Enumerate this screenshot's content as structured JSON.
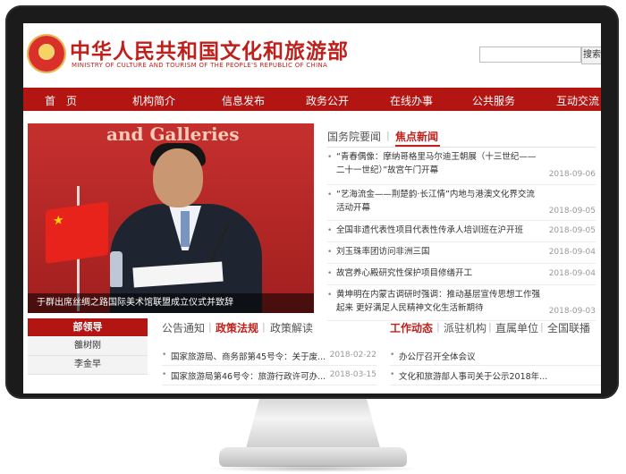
{
  "header": {
    "title": "中华人民共和国文化和旅游部",
    "subtitle": "MINISTRY OF CULTURE AND TOURISM OF THE PEOPLE'S REPUBLIC OF CHINA",
    "search_button": "搜索"
  },
  "nav": [
    "首　页",
    "机构简介",
    "信息发布",
    "政务公开",
    "在线办事",
    "公共服务",
    "互动交流"
  ],
  "hero": {
    "background_text": "and Galleries",
    "caption": "于群出席丝绸之路国际美术馆联盟成立仪式并致辞"
  },
  "news_tabs": [
    "国务院要闻",
    "焦点新闻"
  ],
  "news": [
    {
      "text": "“青春偶像：摩纳哥格里马尔迪王朝展（十三世纪——二十一世纪）”故宫午门开幕",
      "date": "2018-09-06"
    },
    {
      "text": "“艺海流金——荆楚韵·长江情”内地与港澳文化界交流活动开幕",
      "date": "2018-09-05"
    },
    {
      "text": "全国非遗代表性项目代表性传承人培训班在沪开班",
      "date": "2018-09-05"
    },
    {
      "text": "刘玉珠率团访问非洲三国",
      "date": "2018-09-04"
    },
    {
      "text": "故宫养心殿研究性保护项目修缮开工",
      "date": "2018-09-04"
    },
    {
      "text": "黄坤明在内蒙古调研时强调：推动基层宣传思想工作强起来 更好满足人民精神文化生活新期待",
      "date": "2018-09-03"
    }
  ],
  "leaders": {
    "header": "部领导",
    "names": [
      "雒树刚",
      "李金早"
    ]
  },
  "policy_tabs": [
    "公告通知",
    "政策法规",
    "政策解读"
  ],
  "policy_list": [
    {
      "text": "国家旅游局、商务部第45号令：关于废...",
      "date": "2018-02-22"
    },
    {
      "text": "国家旅游局第46号令：旅游行政许可办...",
      "date": "2018-03-15"
    }
  ],
  "work_tabs": [
    "工作动态",
    "派驻机构",
    "直属单位",
    "全国联播"
  ],
  "work_list": [
    {
      "text": "办公厅召开全体会议"
    },
    {
      "text": "文化和旅游部人事司关于公示2018年..."
    }
  ],
  "colors": {
    "brand_red": "#b31513",
    "title_red": "#c0201c"
  }
}
